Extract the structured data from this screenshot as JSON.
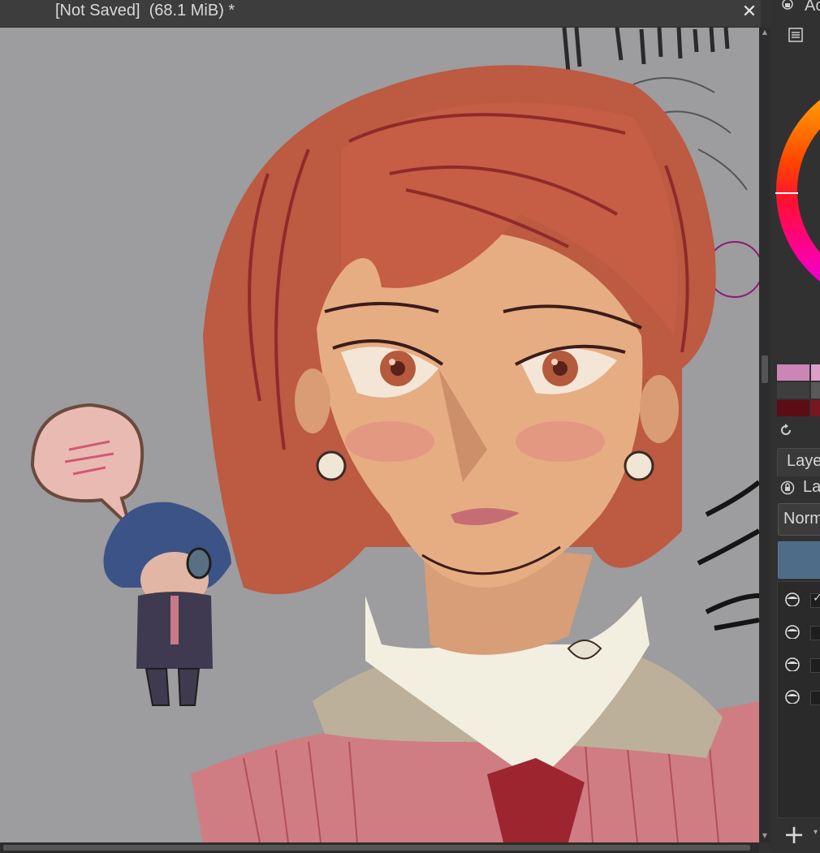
{
  "document": {
    "title": "[Not Saved]  (68.1 MiB) *",
    "close_glyph": "✕"
  },
  "docker": {
    "panel_title": "Ac",
    "layers_tab": "Laye",
    "layer_label": "La",
    "blend_mode": "Norm",
    "add_glyph": "+",
    "checkmark": "✓"
  },
  "palette": {
    "swatches": [
      "#cc86b6",
      "#dd9fc8",
      "#3e3e3e",
      "#595959",
      "#5c0d14",
      "#7a1620"
    ],
    "opacity_color": "#4e6b88",
    "canvas_bg": "#9d9c9e"
  },
  "layers": [
    {
      "visible": true,
      "checked": true
    },
    {
      "visible": true,
      "checked": false
    },
    {
      "visible": true,
      "checked": false
    },
    {
      "visible": true,
      "checked": false
    }
  ]
}
